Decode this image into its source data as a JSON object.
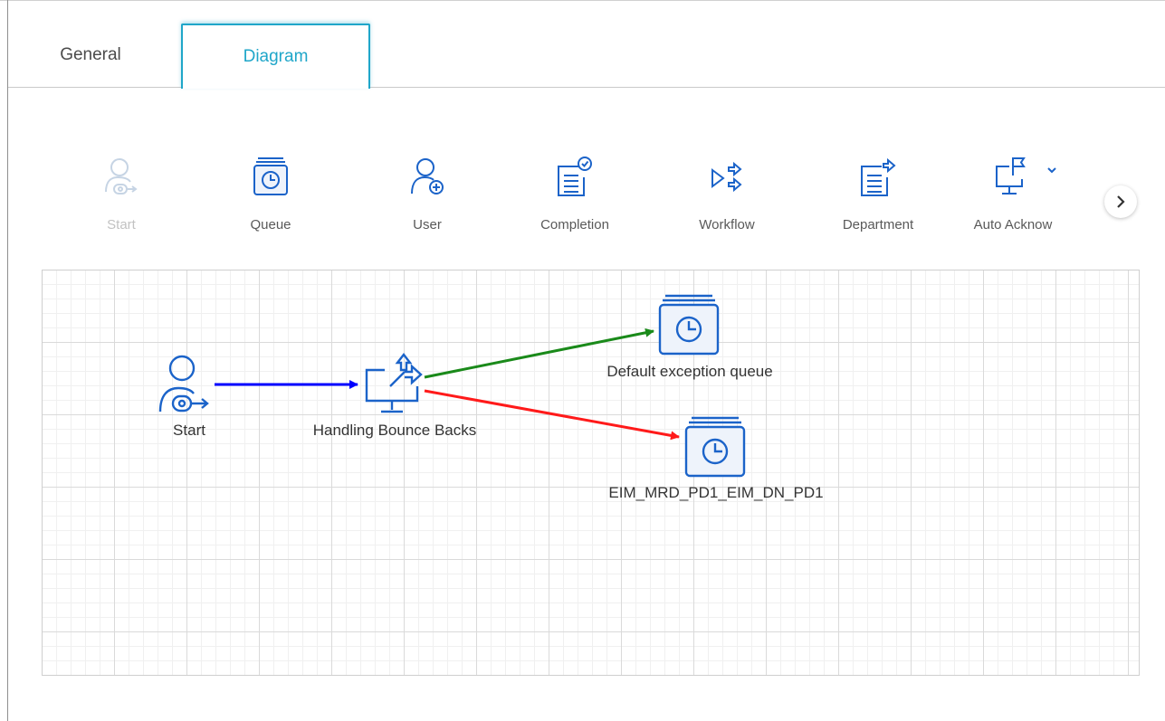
{
  "tabs": [
    {
      "label": "General",
      "active": false
    },
    {
      "label": "Diagram",
      "active": true
    }
  ],
  "palette": {
    "items": [
      {
        "label": "Start",
        "icon": "start-user-icon",
        "disabled": true
      },
      {
        "label": "Queue",
        "icon": "queue-icon",
        "disabled": false
      },
      {
        "label": "User",
        "icon": "add-user-icon",
        "disabled": false
      },
      {
        "label": "Completion",
        "icon": "completion-icon",
        "disabled": false
      },
      {
        "label": "Workflow",
        "icon": "workflow-icon",
        "disabled": false
      },
      {
        "label": "Department",
        "icon": "department-icon",
        "disabled": false
      },
      {
        "label": "Auto Acknow",
        "icon": "auto-acknowledgement-icon",
        "disabled": false
      }
    ],
    "next_icon": "chevron-right-icon"
  },
  "diagram": {
    "nodes": {
      "start": {
        "label": "Start",
        "icon": "start-user-icon"
      },
      "bounce": {
        "label": "Handling Bounce Backs",
        "icon": "monitor-branch-icon"
      },
      "default_queue": {
        "label": "Default exception queue",
        "icon": "queue-icon"
      },
      "eim_queue": {
        "label": "EIM_MRD_PD1_EIM_DN_PD1",
        "icon": "queue-icon"
      }
    },
    "connections": [
      {
        "from": "Start",
        "to": "Handling Bounce Backs",
        "color": "#0000ff"
      },
      {
        "from": "Handling Bounce Backs",
        "to": "Default exception queue",
        "color": "#1a8a1a"
      },
      {
        "from": "Handling Bounce Backs",
        "to": "EIM_MRD_PD1_EIM_DN_PD1",
        "color": "#ff1a1a"
      }
    ]
  },
  "colors": {
    "accent": "#1fa6c9",
    "node_blue": "#1b63c9",
    "disabled": "#c2c2c2"
  }
}
